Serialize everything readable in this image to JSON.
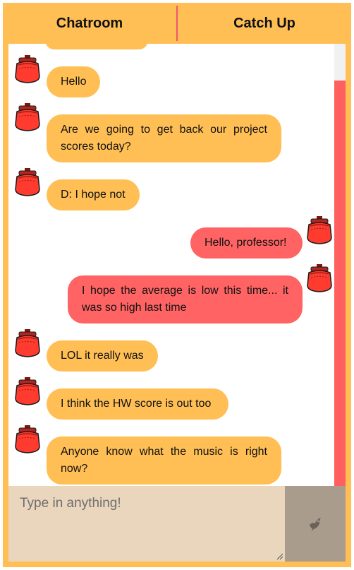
{
  "tabs": [
    {
      "label": "Chatroom"
    },
    {
      "label": "Catch Up"
    }
  ],
  "messages": [
    {
      "text": "Hello",
      "direction": "incoming"
    },
    {
      "text": "Are we going to get back our project scores today?",
      "direction": "incoming"
    },
    {
      "text": "D: I hope not",
      "direction": "incoming"
    },
    {
      "text": "Hello, professor!",
      "direction": "outgoing"
    },
    {
      "text": "I hope the average is low this time... it was so high last time",
      "direction": "outgoing"
    },
    {
      "text": "LOL it really was",
      "direction": "incoming"
    },
    {
      "text": "I think the HW score is out too",
      "direction": "incoming"
    },
    {
      "text": "Anyone know what the music is right now?",
      "direction": "incoming"
    }
  ],
  "composer": {
    "placeholder": "Type in anything!",
    "value": "",
    "send_icon": "bird-icon"
  },
  "colors": {
    "frame": "#ffbf55",
    "incoming_bubble": "#ffbf55",
    "outgoing_bubble": "#ff6363",
    "tab_divider": "#f0566a",
    "scrollbar_thumb": "#ff5f5f",
    "input_background": "#e9d6bd",
    "send_button": "#a99c8c"
  }
}
